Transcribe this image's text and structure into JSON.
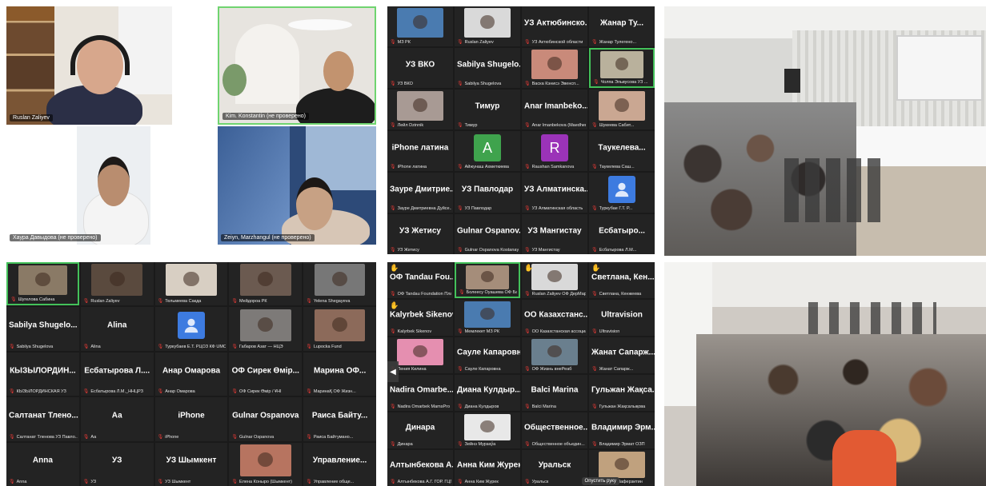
{
  "panel_top_left": {
    "tiles": [
      {
        "name": "Ruslan Zaliyev"
      },
      {
        "name": "Kim. Konstantin (не проверено)"
      },
      {
        "name": "Хаура Давыдова (не проверено)"
      },
      {
        "name": "Zeiyn, Marzhangul (не проверено)"
      }
    ]
  },
  "panel_top_middle": {
    "cells": [
      {
        "title": "",
        "label": "МЗ РК",
        "video": "#4a7bb0"
      },
      {
        "title": "",
        "label": "Ruslan Zaliyev",
        "video": "#d9d9d9"
      },
      {
        "title": "УЗ Актюбинско...",
        "label": "УЗ Актюбинской области",
        "video": ""
      },
      {
        "title": "Жанар Ту...",
        "label": "Жанар Тулегено...",
        "video": ""
      },
      {
        "title": "УЗ ВКО",
        "label": "УЗ ВКО",
        "video": ""
      },
      {
        "title": "Sabilya Shugelo...",
        "label": "Sabilya Shugelova",
        "video": ""
      },
      {
        "title": "",
        "label": "Васка Кэнисэ Эвенсп...",
        "video": "#c98a7a"
      },
      {
        "title": "",
        "label": "Чолпа Эльвусова УЗ ...",
        "video": "#b9b19c",
        "speaking": true
      },
      {
        "title": "",
        "label": "Лейл Dzinnik",
        "video": "#a89a94"
      },
      {
        "title": "Тимур",
        "label": "Тимур",
        "video": ""
      },
      {
        "title": "Anar Imanbeko...",
        "label": "Anar Imanbekova (Maedhem...)",
        "video": ""
      },
      {
        "title": "",
        "label": "Шукеева Сабит...",
        "video": "#caa792"
      },
      {
        "title": "iPhone латина",
        "label": "iPhone латина",
        "video": ""
      },
      {
        "title": "",
        "label": "Айжунаш Ахметкиева",
        "avatar": "A",
        "avatar_color": "#3fa34d"
      },
      {
        "title": "",
        "label": "Raushan Samkanova",
        "avatar": "R",
        "avatar_color": "#9b33b8"
      },
      {
        "title": "Таукелева...",
        "label": "Таукелева Саш...",
        "video": ""
      },
      {
        "title": "Зауре Дмитрие...",
        "label": "Зауре Дмитриевна Дуйсе...",
        "video": ""
      },
      {
        "title": "УЗ Павлодар",
        "label": "УЗ Павлодар",
        "video": ""
      },
      {
        "title": "УЗ Алматинска...",
        "label": "УЗ Алматинская область",
        "video": ""
      },
      {
        "title": "",
        "label": "Туркубае Г.Т. Р...",
        "avatar": "user",
        "avatar_color": "#3d7be0"
      },
      {
        "title": "УЗ Жетису",
        "label": "УЗ Жетису",
        "video": ""
      },
      {
        "title": "Gulnar Ospanov...",
        "label": "Gulnar Ospanova Kostanay",
        "video": ""
      },
      {
        "title": "УЗ Мангистау",
        "label": "УЗ Мангистау",
        "video": ""
      },
      {
        "title": "Есбатыро...",
        "label": "Есбатырова Л.М...",
        "video": ""
      }
    ]
  },
  "panel_bottom_left": {
    "cells": [
      {
        "title": "",
        "label": "Шугелова Сабина",
        "video": "#8a7a66",
        "speaking": true
      },
      {
        "title": "",
        "label": "Ruslan Zaliyev",
        "video": "#5a4a3e"
      },
      {
        "title": "",
        "label": "Тельмеева Сакда",
        "video": "#d8cfc3"
      },
      {
        "title": "",
        "label": "Мейдороа РК",
        "video": "#6b5a50"
      },
      {
        "title": "",
        "label": "Yelena Shegayeva",
        "video": "#777777"
      },
      {
        "title": "Sabilya Shugelo...",
        "label": "Sabilya Shugelova",
        "video": ""
      },
      {
        "title": "Alina",
        "label": "Alina",
        "video": ""
      },
      {
        "title": "",
        "label": "Туркубаев Е.Т. РЦОЗ КФ UMC",
        "avatar": "user",
        "avatar_color": "#3d7be0"
      },
      {
        "title": "",
        "label": "Габаров Азат — НЦЭ",
        "video": "#7d7a78"
      },
      {
        "title": "",
        "label": "Lupocka Fund",
        "video": "#8c6a5a"
      },
      {
        "title": "КЫЗЫЛОРДИН...",
        "label": "КЫЗЫЛОРДИНСКАЯ УЗ",
        "video": ""
      },
      {
        "title": "Есбатырова Л....",
        "label": "Есбатырова Л.М._ННЦРЗ",
        "video": ""
      },
      {
        "title": "Анар Омарова",
        "label": "Анар Омарова",
        "video": ""
      },
      {
        "title": "ОФ Сирек Өмір...",
        "label": "ОФ Сирек Өмір / ҰНІ",
        "video": ""
      },
      {
        "title": "Марина ОФ...",
        "label": "МаринаҚ ОФ Жизн...",
        "video": ""
      },
      {
        "title": "Салтанат Тлено...",
        "label": "Салтанат Тленова УЗ Павло...",
        "video": ""
      },
      {
        "title": "Аа",
        "label": "Аа",
        "video": ""
      },
      {
        "title": "iPhone",
        "label": "iPhone",
        "video": ""
      },
      {
        "title": "Gulnar Ospanova",
        "label": "Gulnar Ospanova",
        "video": ""
      },
      {
        "title": "Раиса Байту...",
        "label": "Раиса Байтумано...",
        "video": ""
      },
      {
        "title": "Anna",
        "label": "Anna",
        "video": ""
      },
      {
        "title": "УЗ",
        "label": "УЗ",
        "video": ""
      },
      {
        "title": "УЗ Шымкент",
        "label": "УЗ Шымкент",
        "video": ""
      },
      {
        "title": "",
        "label": "Елена Коныро (Шымкент)",
        "video": "#b77460"
      },
      {
        "title": "Управление...",
        "label": "Управление обще...",
        "video": ""
      }
    ]
  },
  "panel_bottom_middle": {
    "cells": [
      {
        "title": "ОФ Tandau Fou...",
        "label": "ОФ Tandau Foundation Пла...",
        "video": "",
        "hand": true
      },
      {
        "title": "",
        "label": "Болеесу Оуашева ОФ Басыт...",
        "video": "#a58d7a",
        "speaking": true
      },
      {
        "title": "",
        "label": "Ruslan Zaliyev ОФ ДерМарт",
        "video": "#d9d9d9",
        "hand": true
      },
      {
        "title": "Светлана, Кен...",
        "label": "Светлана, Кенжеева",
        "video": "",
        "hand": true
      },
      {
        "title": "Kalyrbek Sikenov",
        "label": "Kalyrbek Sikenov",
        "video": "",
        "hand": true
      },
      {
        "title": "",
        "label": "Мемлекет МЗ РК",
        "video": "#4a7bb0"
      },
      {
        "title": "ОО Казахстанс...",
        "label": "ОО Казахстанская ассоциа...",
        "video": ""
      },
      {
        "title": "Ultravision",
        "label": "Ultravision",
        "video": ""
      },
      {
        "title": "",
        "label": "Ления Килина",
        "video": "#e58fb0"
      },
      {
        "title": "Сауле Капаровна",
        "label": "Сауле Капаровна",
        "video": ""
      },
      {
        "title": "",
        "label": "ОФ Жизнь внеРеаб",
        "video": "#6a7f8e"
      },
      {
        "title": "Жанат Сапарж...",
        "label": "Жанат Сапарж...",
        "video": ""
      },
      {
        "title": "Nadira Omarbe...",
        "label": "Nadira Omarbek MamsPro",
        "video": ""
      },
      {
        "title": "Диана Кулдыр...",
        "label": "Диана Кулдыров",
        "video": ""
      },
      {
        "title": "Balci Marina",
        "label": "Balci Marina",
        "video": ""
      },
      {
        "title": "Гульжан Жақса...",
        "label": "Гульжан Жақсалықова",
        "video": ""
      },
      {
        "title": "Динара",
        "label": "Динара",
        "video": ""
      },
      {
        "title": "",
        "label": "Зейнэ Мурзаўа",
        "video": "#e8e8e8"
      },
      {
        "title": "Общественное...",
        "label": "Общественное объедин...",
        "video": ""
      },
      {
        "title": "Владимир Эрм...",
        "label": "Владимир Эрмат ОЗП",
        "video": ""
      },
      {
        "title": "Алтынбекова А...",
        "label": "Алтынбекова А.Г. ГОР. ГЦП...",
        "video": ""
      },
      {
        "title": "Анна Ким Журек",
        "label": "Анна Ким Журек",
        "video": ""
      },
      {
        "title": "Уральск",
        "label": "Уральск",
        "video": "",
        "pill": "Опустить руку"
      },
      {
        "title": "",
        "label": "Гульсен Маферзитин",
        "video": "#c0a17e"
      }
    ]
  },
  "photos": [
    {
      "alt": "conference-room-photo-1"
    },
    {
      "alt": "conference-room-photo-2"
    }
  ],
  "colors": {
    "zoom_bg": "#1a1a1a",
    "cell_bg": "#232323",
    "speaker_border": "#43c15a",
    "mic_muted": "#e53935"
  }
}
